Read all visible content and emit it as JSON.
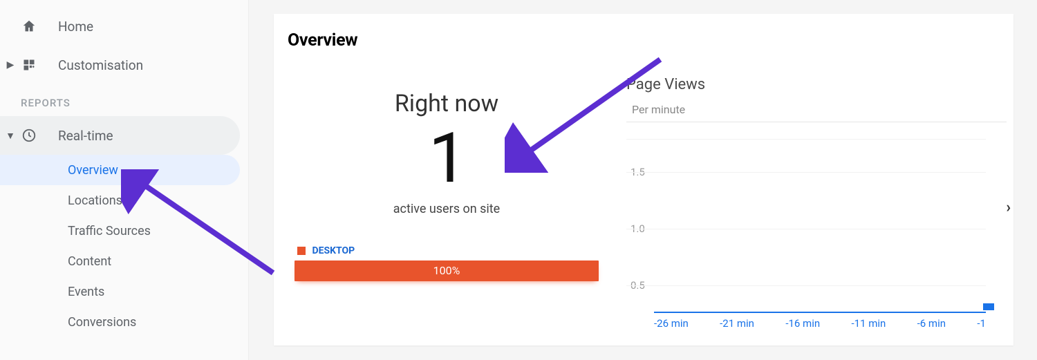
{
  "sidebar": {
    "home": "Home",
    "customisation": "Customisation",
    "reports_header": "REPORTS",
    "realtime": {
      "label": "Real-time",
      "items": [
        "Overview",
        "Locations",
        "Traffic Sources",
        "Content",
        "Events",
        "Conversions"
      ],
      "active_index": 0
    }
  },
  "page": {
    "title": "Overview",
    "right_now_label": "Right now",
    "active_users_count": "1",
    "active_users_caption": "active users on site",
    "device_legend": {
      "label": "DESKTOP",
      "color": "#e8542c",
      "percent_label": "100%",
      "percent_value": 100
    }
  },
  "chart_data": {
    "type": "bar",
    "title": "Page Views",
    "subtitle": "Per minute",
    "x_labels": [
      "-26 min",
      "-21 min",
      "-16 min",
      "-11 min",
      "-6 min",
      "-1"
    ],
    "y_ticks": [
      "0.5",
      "1.0",
      "1.5"
    ],
    "ylim": [
      0,
      2
    ],
    "series": [
      {
        "name": "Page views",
        "color": "#1a73e8",
        "values": [
          0,
          0,
          0,
          0,
          0,
          0,
          0,
          0,
          0,
          0,
          0,
          0,
          0,
          0,
          0,
          0,
          0,
          0,
          0,
          0,
          0,
          0,
          0,
          0,
          0,
          1
        ]
      }
    ]
  },
  "colors": {
    "accent_blue": "#1a73e8",
    "accent_orange": "#e8542c",
    "arrow_purple": "#5c2ed1"
  }
}
